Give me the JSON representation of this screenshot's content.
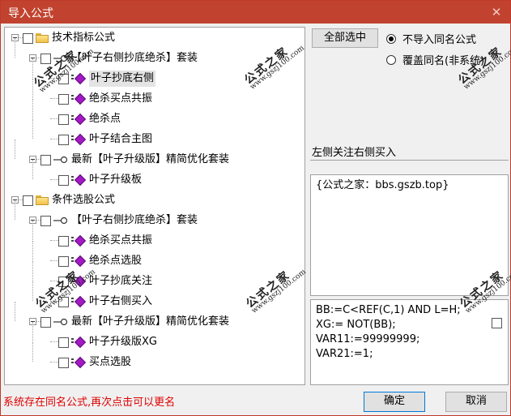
{
  "window": {
    "title": "导入公式",
    "close_glyph": "✕"
  },
  "tree": [
    {
      "level": 0,
      "kind": "folder",
      "label": "技术指标公式",
      "expand": true
    },
    {
      "level": 1,
      "kind": "set",
      "label": "【叶子右侧抄底绝杀】套装",
      "expand": true
    },
    {
      "level": 2,
      "kind": "item",
      "label": "叶子抄底右侧",
      "selected": true
    },
    {
      "level": 2,
      "kind": "item",
      "label": "绝杀买点共振"
    },
    {
      "level": 2,
      "kind": "item",
      "label": "绝杀点"
    },
    {
      "level": 2,
      "kind": "item",
      "label": "叶子结合主图"
    },
    {
      "level": 1,
      "kind": "set",
      "label": "最新【叶子升级版】精简优化套装",
      "expand": true
    },
    {
      "level": 2,
      "kind": "item",
      "label": "叶子升级板"
    },
    {
      "level": 0,
      "kind": "folder",
      "label": "条件选股公式",
      "expand": true
    },
    {
      "level": 1,
      "kind": "set",
      "label": "【叶子右侧抄底绝杀】套装",
      "expand": true
    },
    {
      "level": 2,
      "kind": "item",
      "label": "绝杀买点共振"
    },
    {
      "level": 2,
      "kind": "item",
      "label": "绝杀点选股"
    },
    {
      "level": 2,
      "kind": "item",
      "label": "叶子抄底关注"
    },
    {
      "level": 2,
      "kind": "item",
      "label": "叶子右侧买入"
    },
    {
      "level": 1,
      "kind": "set",
      "label": "最新【叶子升级版】精简优化套装",
      "expand": true
    },
    {
      "level": 2,
      "kind": "item",
      "label": "叶子升级版XG"
    },
    {
      "level": 2,
      "kind": "item",
      "label": "买点选股"
    }
  ],
  "watermark": {
    "big": "公式之家",
    "small": "www.gszj100.com"
  },
  "right": {
    "select_all": "全部选中",
    "radio_options": [
      {
        "label": "不导入同名公式",
        "checked": true
      },
      {
        "label": "覆盖同名(非系统)",
        "checked": false
      }
    ],
    "description": "左侧关注右侧买入",
    "info": "{公式之家：bbs.gszb.top}",
    "code_lines": [
      "BB:=C<REF(C,1) AND L=H;",
      "XG:= NOT(BB);",
      "VAR11:=99999999;",
      "VAR21:=1;"
    ]
  },
  "footer": {
    "status": "系统存在同名公式,再次点击可以更名",
    "ok": "确定",
    "cancel": "取消"
  },
  "colors": {
    "titlebar": "#c1432f",
    "status": "#e00000",
    "item_icon": "#a319c4"
  }
}
